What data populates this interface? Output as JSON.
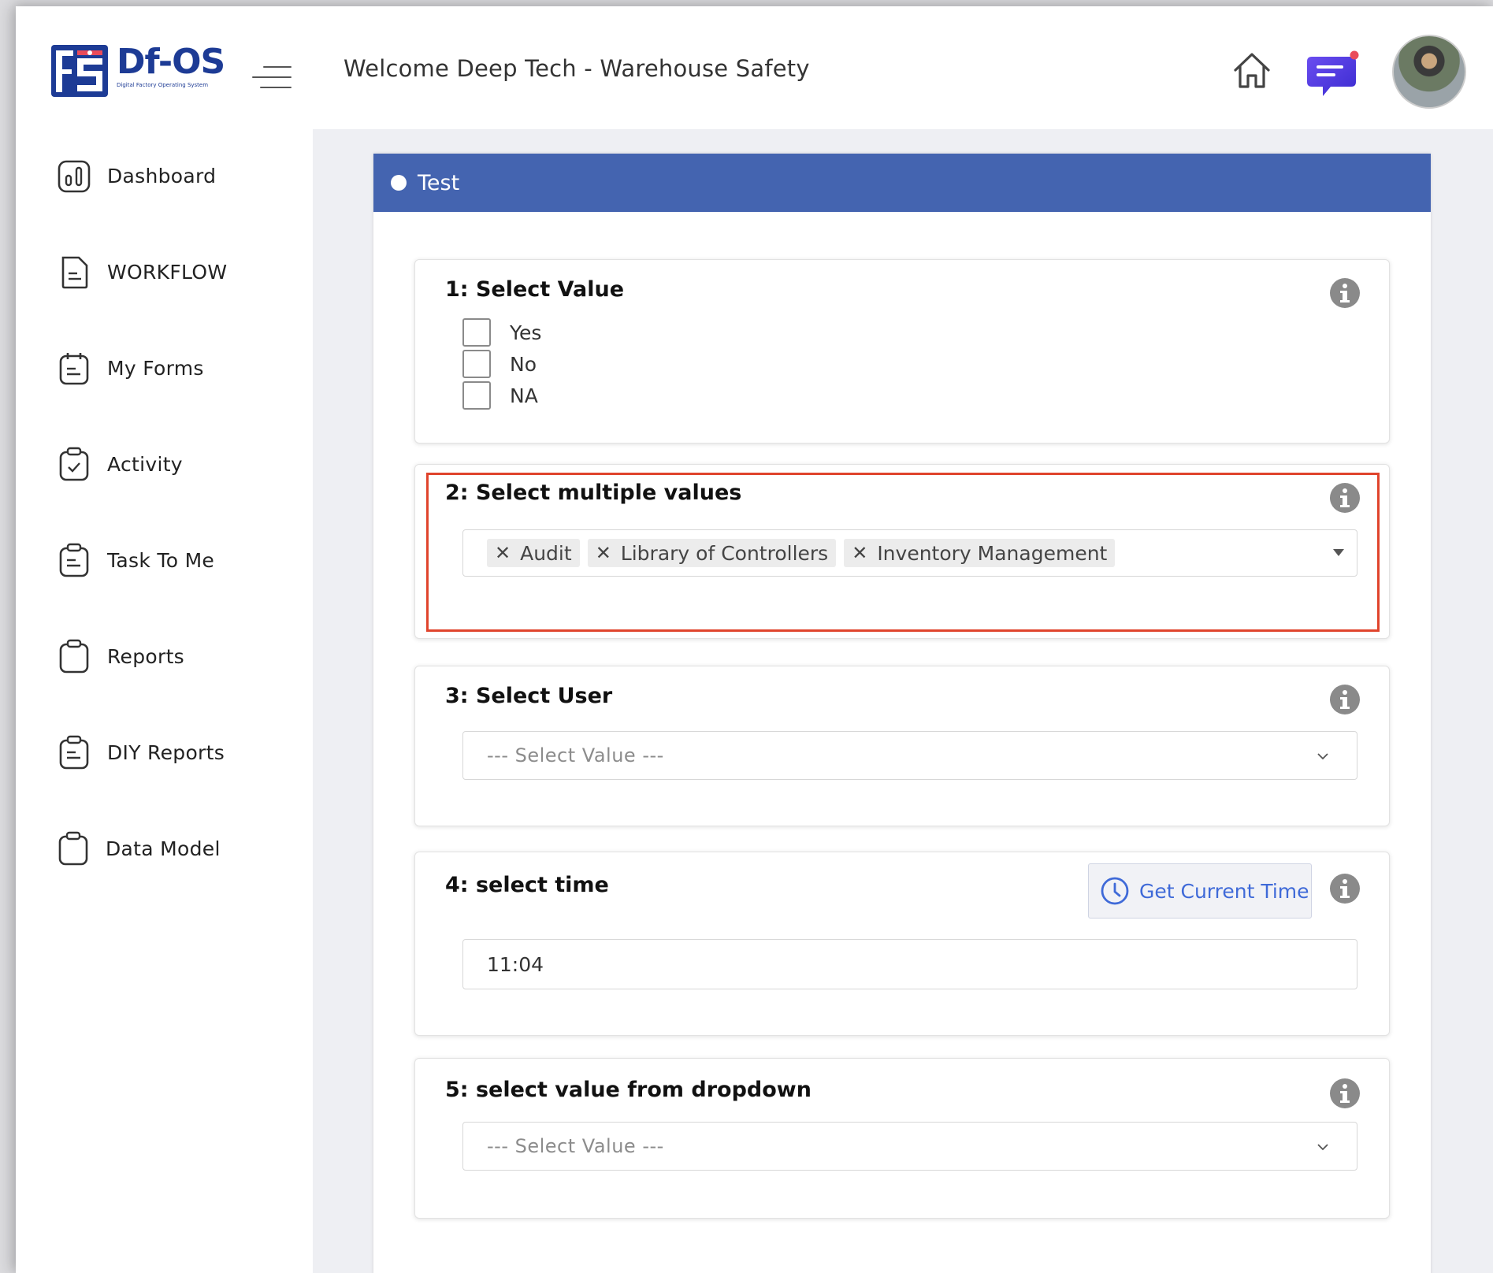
{
  "app": {
    "logo_title": "Df-OS",
    "logo_subtitle": "Digital Factory Operating System"
  },
  "sidebar": {
    "items": [
      {
        "label": "Dashboard",
        "icon": "dashboard-icon"
      },
      {
        "label": "WORKFLOW",
        "icon": "workflow-icon"
      },
      {
        "label": "My Forms",
        "icon": "forms-icon"
      },
      {
        "label": "Activity",
        "icon": "activity-icon"
      },
      {
        "label": "Task To Me",
        "icon": "task-icon"
      },
      {
        "label": "Reports",
        "icon": "reports-icon"
      },
      {
        "label": "DIY Reports",
        "icon": "diy-reports-icon"
      },
      {
        "label": "Data Model",
        "icon": "data-model-icon"
      }
    ]
  },
  "header": {
    "title": "Welcome Deep Tech - Warehouse Safety",
    "notification_color": "#e94b5a",
    "accent": "#4464b0"
  },
  "form": {
    "title": "Test",
    "questions": {
      "q1": {
        "title": "1: Select Value",
        "options": [
          "Yes",
          "No",
          "NA"
        ]
      },
      "q2": {
        "title": "2: Select multiple values",
        "chips": [
          "Audit",
          "Library of Controllers",
          "Inventory Management"
        ],
        "chip_remove": "✕"
      },
      "q3": {
        "title": "3: Select User",
        "placeholder": "--- Select Value ---"
      },
      "q4": {
        "title": "4: select time",
        "button_label": "Get Current Time",
        "value": "11:04"
      },
      "q5": {
        "title": "5: select value from dropdown",
        "placeholder": "--- Select Value ---"
      }
    }
  }
}
